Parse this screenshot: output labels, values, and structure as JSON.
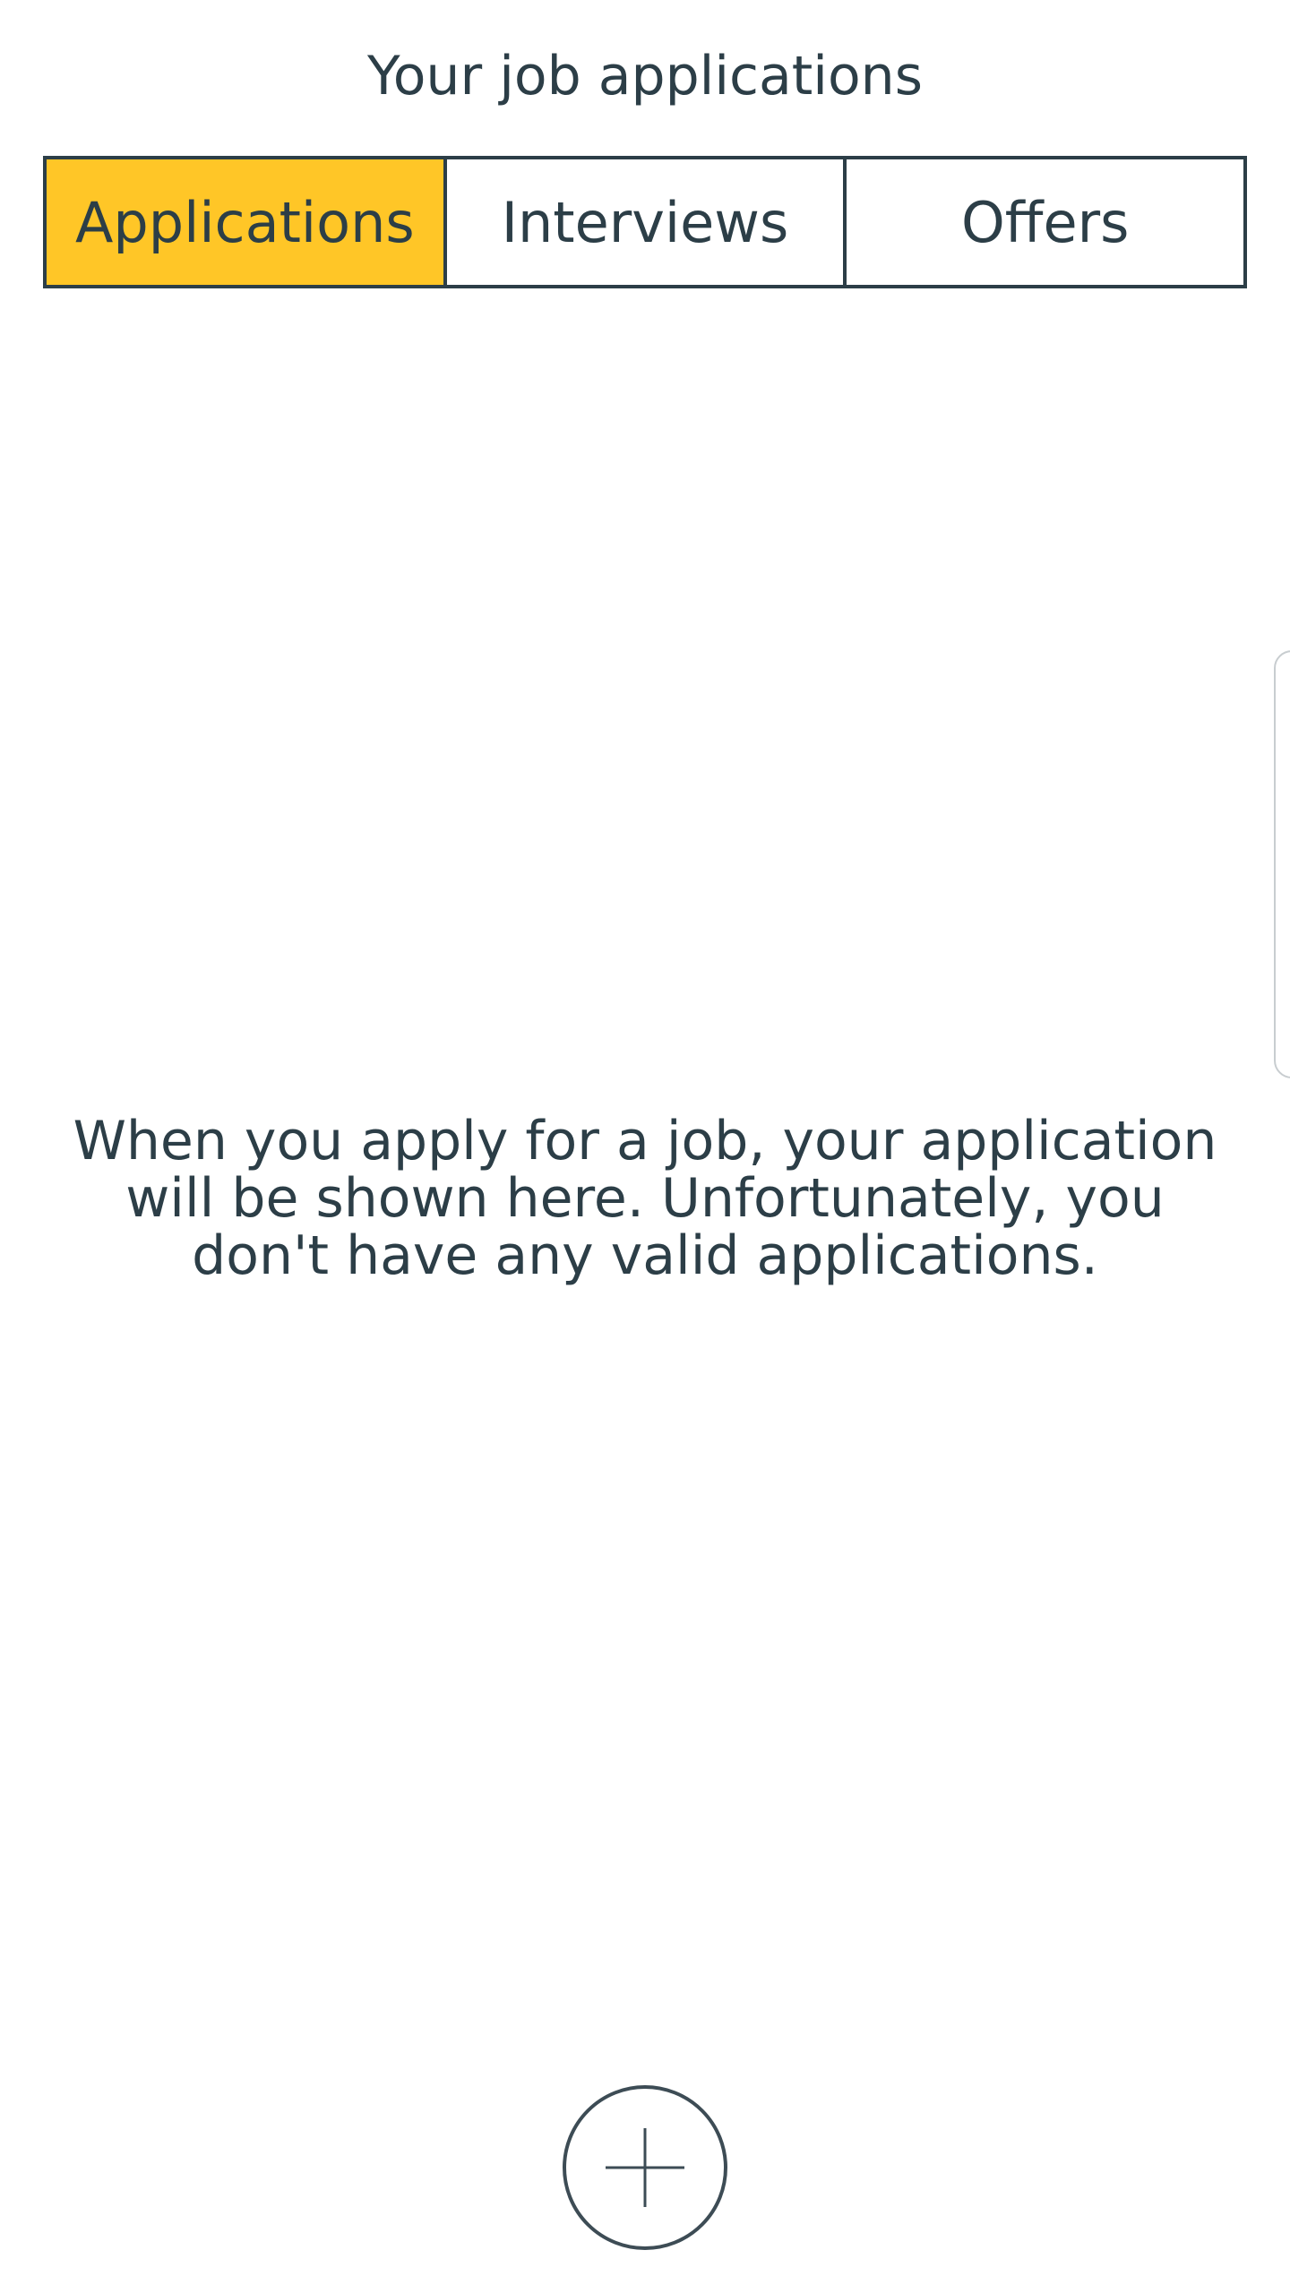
{
  "header": {
    "title": "Your job applications"
  },
  "tabs": [
    {
      "label": "Applications",
      "active": true
    },
    {
      "label": "Interviews",
      "active": false
    },
    {
      "label": "Offers",
      "active": false
    }
  ],
  "main": {
    "empty_message": "When you apply for a job, your application will be shown here. Unfortunately, you don't have any valid applications."
  },
  "fab": {
    "icon": "plus-icon"
  },
  "colors": {
    "accent": "#ffc627",
    "text": "#2c3e47",
    "background": "#ffffff"
  }
}
